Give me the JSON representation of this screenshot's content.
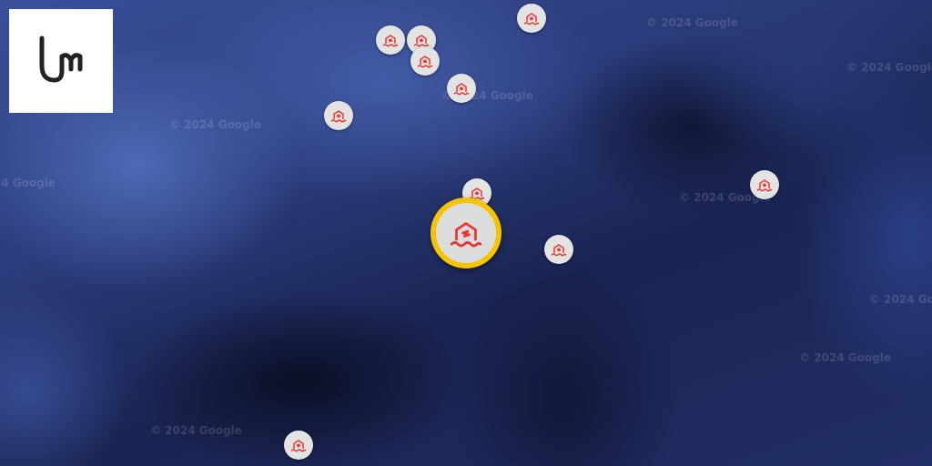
{
  "map": {
    "watermark_text": "© 2024 Google",
    "marker_icon": "flood-house-icon",
    "marker_color": "#e53935",
    "selected_ring_color": "#f5c400"
  },
  "logo": {
    "icon": "um-logo-icon"
  }
}
